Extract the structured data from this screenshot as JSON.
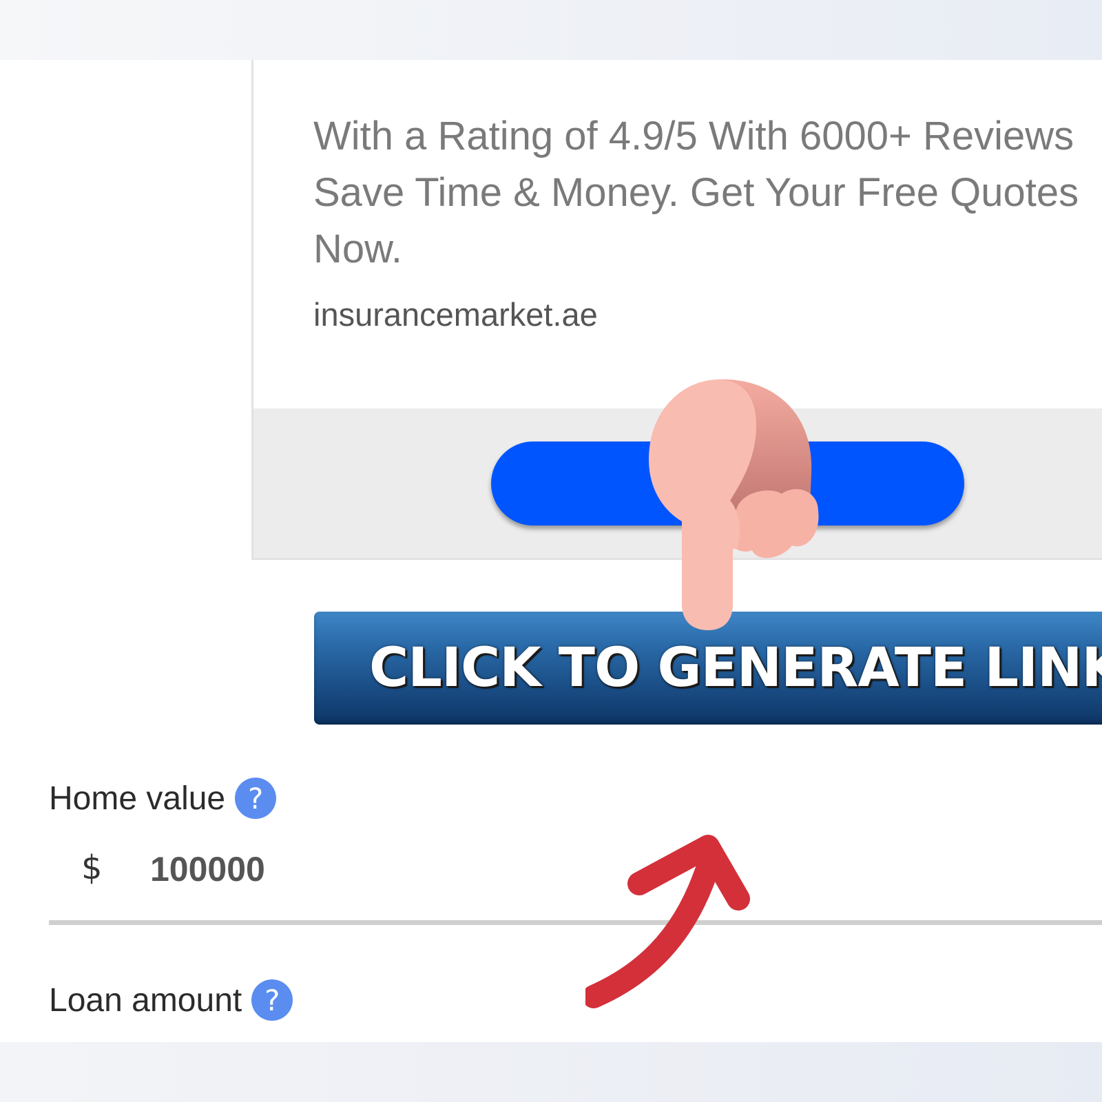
{
  "ad": {
    "description": "With a Rating of 4.9/5 With 6000+ Reviews Save Time & Money. Get Your Free Quotes Now.",
    "domain": "insurancemarket.ae",
    "cta_label": ""
  },
  "generate_button": {
    "label": "CLICK TO GENERATE LINK"
  },
  "form": {
    "home_value": {
      "label": "Home value",
      "help_icon": "?",
      "currency": "$",
      "value": "100000"
    },
    "loan_amount": {
      "label": "Loan amount",
      "help_icon": "?"
    }
  },
  "overlays": {
    "hand": "pointing-hand-icon",
    "arrow": "curved-arrow-icon"
  },
  "colors": {
    "ad_cta": "#0055ff",
    "generate_button_top": "#3f86c7",
    "generate_button_bottom": "#0d3566",
    "help_icon": "#5b8df0",
    "arrow": "#d3303a",
    "hand": "#f9b9ad"
  }
}
